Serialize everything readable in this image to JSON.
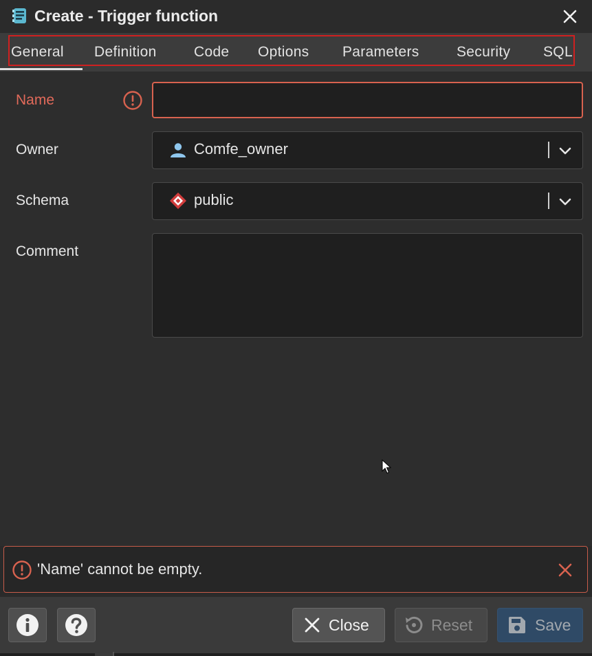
{
  "window": {
    "title": "Create - Trigger function"
  },
  "tabs": [
    {
      "label": "General",
      "active": true
    },
    {
      "label": "Definition"
    },
    {
      "label": "Code"
    },
    {
      "label": "Options"
    },
    {
      "label": "Parameters"
    },
    {
      "label": "Security"
    },
    {
      "label": "SQL"
    }
  ],
  "form": {
    "name": {
      "label": "Name",
      "value": "",
      "status": "error"
    },
    "owner": {
      "label": "Owner",
      "value": "Comfe_owner",
      "icon": "user-icon"
    },
    "schema": {
      "label": "Schema",
      "value": "public",
      "icon": "schema-diamond-icon"
    },
    "comment": {
      "label": "Comment",
      "value": ""
    }
  },
  "alert": {
    "message": "'Name' cannot be empty.",
    "icon": "error-circle-icon"
  },
  "footer": {
    "info_icon": "info-icon",
    "help_icon": "help-icon",
    "close_label": "Close",
    "reset_label": "Reset",
    "save_label": "Save"
  },
  "colors": {
    "error": "#d8624f",
    "accent_save": "#2f4a66",
    "panel": "#2d2d2d",
    "tab_frame": "#d02020"
  }
}
